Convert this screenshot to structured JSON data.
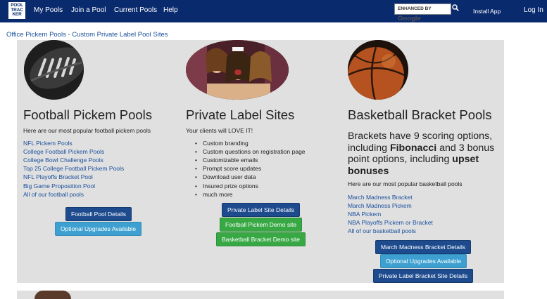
{
  "nav": {
    "logo_lines": [
      "POOL",
      "TRAC",
      "KER"
    ],
    "links": [
      "My Pools",
      "Join a Pool",
      "Current Pools",
      "Help"
    ],
    "search_prefix": "ENHANCED BY",
    "search_brand": "Google",
    "install_app": "Install App",
    "login": "Log In"
  },
  "breadcrumb": "Office Pickem Pools - Custom Private Label Pool Sites",
  "football": {
    "title": "Football Pickem Pools",
    "intro": "Here are our most popular football pickem pools",
    "links": [
      "NFL Pickem Pools",
      "College Football Pickem Pools",
      "College Bowl Challenge Pools",
      "Top 25 College Football Pickem Pools",
      "NFL Playoffs Bracket Pool",
      "Big Game Proposition Pool",
      "All of our football pools"
    ],
    "details_btn": "Football Pool Details",
    "upgrades_btn": "Optional Upgrades Available"
  },
  "private": {
    "title": "Private Label Sites",
    "intro": "Your clients will LOVE IT!",
    "bullets": [
      "Custom branding",
      "Custom questions on registration page",
      "Customizable emails",
      "Prompt score updates",
      "Download user data",
      "Insured prize options",
      "much more"
    ],
    "details_btn": "Private Label Site Details",
    "football_demo_btn": "Football Pickem Demo site",
    "basketball_demo_btn": "Basketball Bracket Demo site"
  },
  "basketball": {
    "title": "Basketball Bracket Pools",
    "blurb_1": "Brackets have 9 scoring options, including ",
    "blurb_bold_1": "Fibonacci",
    "blurb_2": " and 3 bonus point options, including ",
    "blurb_bold_2": "upset bonuses",
    "intro": "Here are our most popular basketball pools",
    "links": [
      "March Madness Bracket",
      "March Madness Pickem",
      "NBA Pickem",
      "NBA Playoffs Pickem or Bracket",
      "All of our basketball pools"
    ],
    "details_btn": "March Madness Bracket Details",
    "upgrades_btn": "Optional Upgrades Available",
    "private_btn": "Private Label Bracket Site Details"
  }
}
